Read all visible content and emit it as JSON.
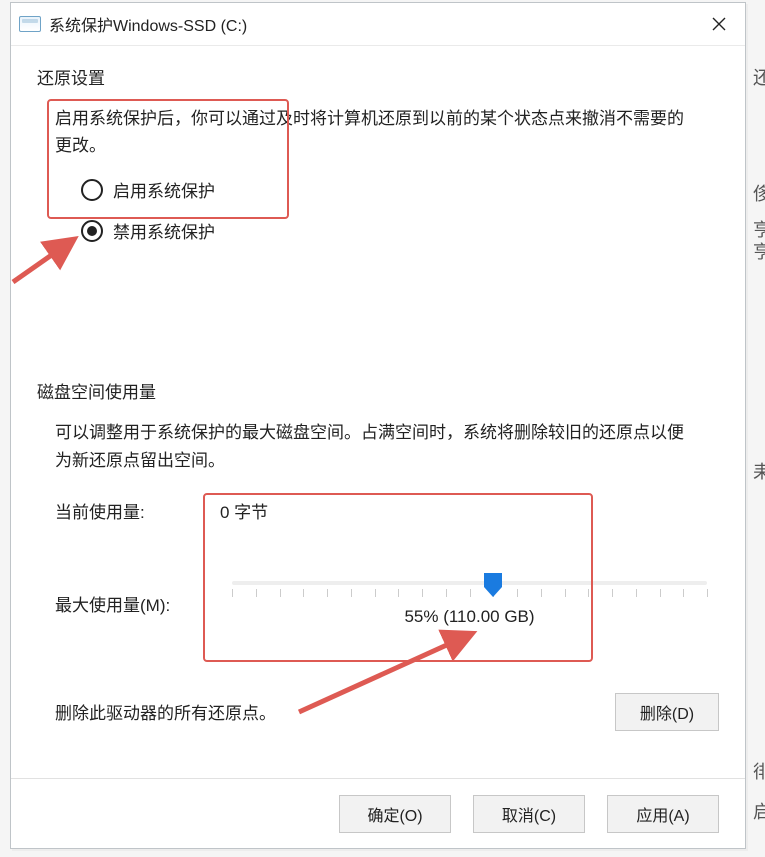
{
  "window": {
    "title": "系统保护Windows-SSD (C:)"
  },
  "restore": {
    "section_title": "还原设置",
    "description": "启用系统保护后，你可以通过及时将计算机还原到以前的某个状态点来撤消不需要的更改。",
    "enable_label": "启用系统保护",
    "disable_label": "禁用系统保护",
    "selected": "disable"
  },
  "disk": {
    "section_title": "磁盘空间使用量",
    "description": "可以调整用于系统保护的最大磁盘空间。占满空间时，系统将删除较旧的还原点以便为新还原点留出空间。",
    "current_usage_label": "当前使用量:",
    "current_usage_value": "0 字节",
    "max_usage_label": "最大使用量(M):",
    "max_usage_percent": 55,
    "max_usage_readout": "55% (110.00 GB)"
  },
  "delete": {
    "text": "删除此驱动器的所有还原点。",
    "button_label": "删除(D)"
  },
  "footer": {
    "ok_label": "确定(O)",
    "cancel_label": "取消(C)",
    "apply_label": "应用(A)"
  },
  "side_fragments": {
    "a": "还",
    "b": "侈",
    "c": "亨",
    "d": "亨",
    "e": "耒",
    "f": "徘",
    "g": "启"
  }
}
